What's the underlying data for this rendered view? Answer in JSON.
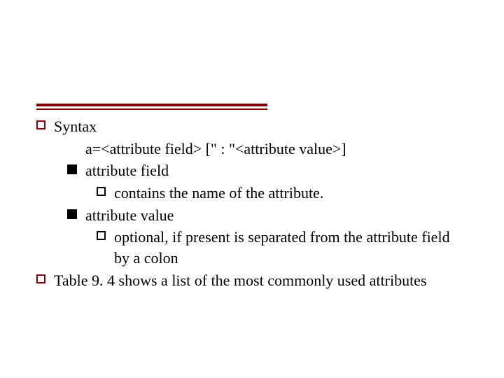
{
  "slide": {
    "items": [
      {
        "level": 0,
        "bullet": "hollow-red",
        "text": "Syntax"
      },
      {
        "level": "1t",
        "bullet": "none",
        "text": "a=<attribute field> [\" : \"<attribute value>]"
      },
      {
        "level": 1,
        "bullet": "solid",
        "text": "attribute field"
      },
      {
        "level": 2,
        "bullet": "hollow-blk",
        "text": "contains the name of the attribute."
      },
      {
        "level": 1,
        "bullet": "solid",
        "text": "attribute value"
      },
      {
        "level": 2,
        "bullet": "hollow-blk",
        "text": "optional, if present is separated from the attribute field by a colon"
      },
      {
        "level": 0,
        "bullet": "hollow-red",
        "text": "Table 9. 4 shows a list of the most commonly used attributes"
      }
    ]
  }
}
